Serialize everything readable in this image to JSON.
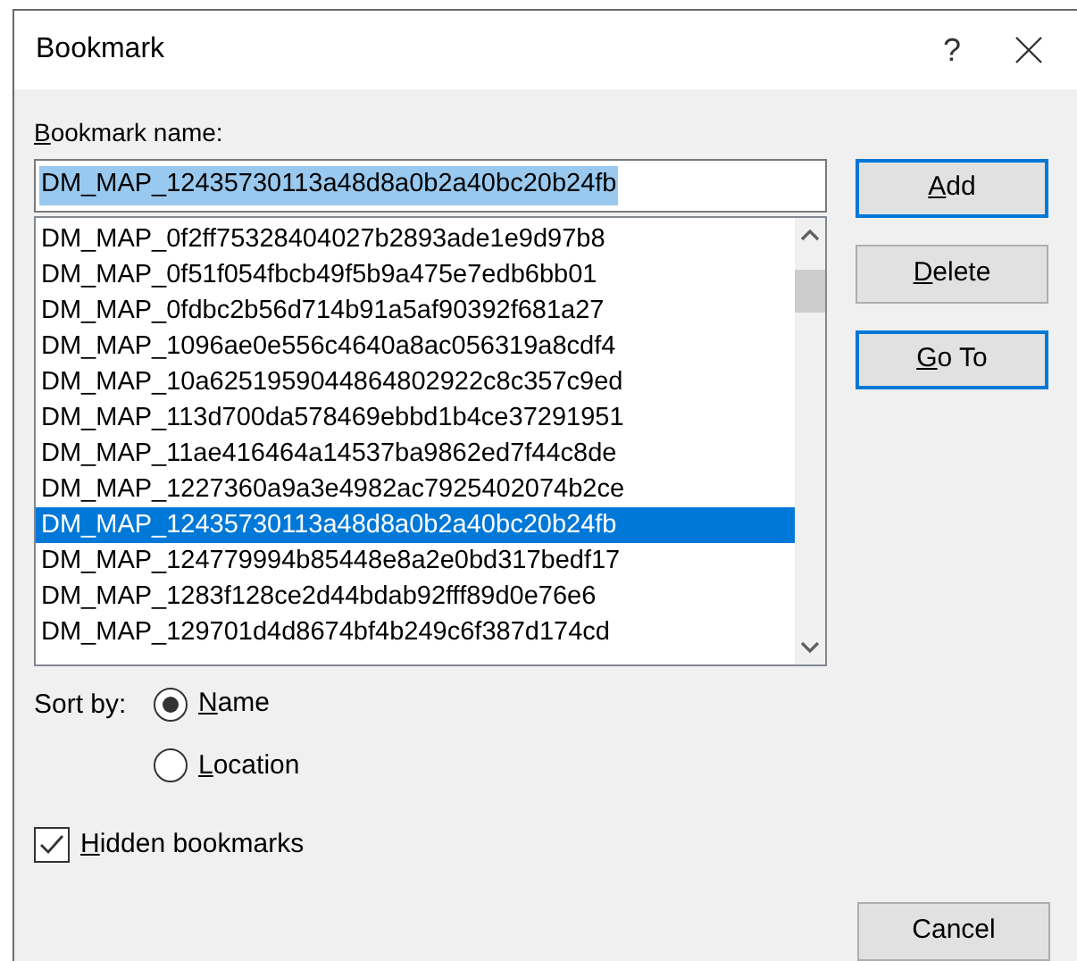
{
  "window": {
    "title": "Bookmark",
    "help": "?"
  },
  "name_field": {
    "label": "Bookmark name:",
    "value": "DM_MAP_12435730113a48d8a0b2a40bc20b24fb"
  },
  "bookmarks": [
    {
      "name": "DM_MAP_0f2ff75328404027b2893ade1e9d97b8",
      "selected": false
    },
    {
      "name": "DM_MAP_0f51f054fbcb49f5b9a475e7edb6bb01",
      "selected": false
    },
    {
      "name": "DM_MAP_0fdbc2b56d714b91a5af90392f681a27",
      "selected": false
    },
    {
      "name": "DM_MAP_1096ae0e556c4640a8ac056319a8cdf4",
      "selected": false
    },
    {
      "name": "DM_MAP_10a6251959044864802922c8c357c9ed",
      "selected": false
    },
    {
      "name": "DM_MAP_113d700da578469ebbd1b4ce37291951",
      "selected": false
    },
    {
      "name": "DM_MAP_11ae416464a14537ba9862ed7f44c8de",
      "selected": false
    },
    {
      "name": "DM_MAP_1227360a9a3e4982ac7925402074b2ce",
      "selected": false
    },
    {
      "name": "DM_MAP_12435730113a48d8a0b2a40bc20b24fb",
      "selected": true
    },
    {
      "name": "DM_MAP_124779994b85448e8a2e0bd317bedf17",
      "selected": false
    },
    {
      "name": "DM_MAP_1283f128ce2d44bdab92fff89d0e76e6",
      "selected": false
    },
    {
      "name": "DM_MAP_129701d4d8674bf4b249c6f387d174cd",
      "selected": false
    }
  ],
  "buttons": [
    {
      "label": "Add",
      "focused": true
    },
    {
      "label": "Delete",
      "focused": false
    },
    {
      "label": "Go To",
      "focused": true
    }
  ],
  "sort_by": {
    "label": "Sort by:",
    "options": [
      {
        "label": "Name",
        "selected": true
      },
      {
        "label": "Location",
        "selected": false
      }
    ]
  },
  "hidden_bookmarks": {
    "label": "Hidden bookmarks",
    "checked": true
  },
  "cancel_button": {
    "label": "Cancel"
  }
}
